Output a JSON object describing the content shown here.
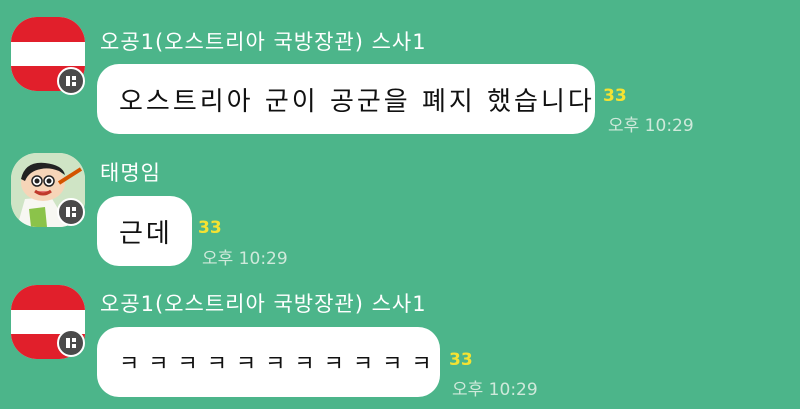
{
  "messages": [
    {
      "sender": "오공1(오스트리아 국방장관) 스사1",
      "text": "오스트리아 군이 공군을 폐지 했습니다",
      "unread": "33",
      "time": "오후 10:29",
      "avatar": "austria-flag"
    },
    {
      "sender": "태명임",
      "text": "근데",
      "unread": "33",
      "time": "오후 10:29",
      "avatar": "cartoon-boy"
    },
    {
      "sender": "오공1(오스트리아 국방장관) 스사1",
      "text": "ㅋ ㅋ ㅋ ㅋ ㅋ ㅋ ㅋ ㅋ ㅋ ㅋ ㅋ",
      "unread": "33",
      "time": "오후 10:29",
      "avatar": "austria-flag"
    }
  ],
  "colors": {
    "background": "#4cb58a",
    "bubble": "#ffffff",
    "unread": "#f4e232",
    "flag_red": "#e11f2b"
  }
}
